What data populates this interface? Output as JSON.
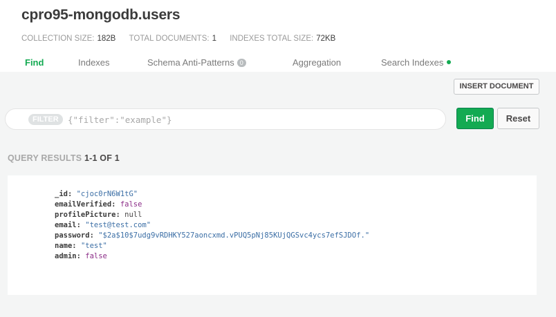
{
  "collection": {
    "title": "cpro95-mongodb.users",
    "stats": [
      {
        "label": "COLLECTION SIZE:",
        "value": "182B"
      },
      {
        "label": "TOTAL DOCUMENTS:",
        "value": "1"
      },
      {
        "label": "INDEXES TOTAL SIZE:",
        "value": "72KB"
      }
    ]
  },
  "tabs": {
    "find": "Find",
    "indexes": "Indexes",
    "schema": "Schema Anti-Patterns",
    "schema_badge": "0",
    "aggregation": "Aggregation",
    "search": "Search Indexes"
  },
  "toolbar": {
    "insert_label": "INSERT DOCUMENT",
    "filter_label": "FILTER",
    "filter_placeholder": "{\"filter\":\"example\"}",
    "filter_value": "",
    "find_label": "Find",
    "reset_label": "Reset"
  },
  "results": {
    "label": "QUERY RESULTS",
    "count": "1-1 OF 1"
  },
  "document": {
    "fields": [
      {
        "key": "_id:",
        "value": "\"cjoc0rN6W1tG\"",
        "type": "string"
      },
      {
        "key": "emailVerified:",
        "value": "false",
        "type": "bool"
      },
      {
        "key": "profilePicture:",
        "value": "null",
        "type": "null"
      },
      {
        "key": "email:",
        "value": "\"test@test.com\"",
        "type": "string"
      },
      {
        "key": "password:",
        "value": "\"$2a$10$7udg9vRDHKY527aoncxmd.vPUQ5pNj85KUjQGSvc4ycs7efSJDOf.\"",
        "type": "string"
      },
      {
        "key": "name:",
        "value": "\"test\"",
        "type": "string"
      },
      {
        "key": "admin:",
        "value": "false",
        "type": "bool"
      }
    ]
  },
  "colors": {
    "accent": "#13aa52",
    "string_value": "#3b6ea5",
    "bool_value": "#8b2c87",
    "background": "#f4f5f5"
  }
}
